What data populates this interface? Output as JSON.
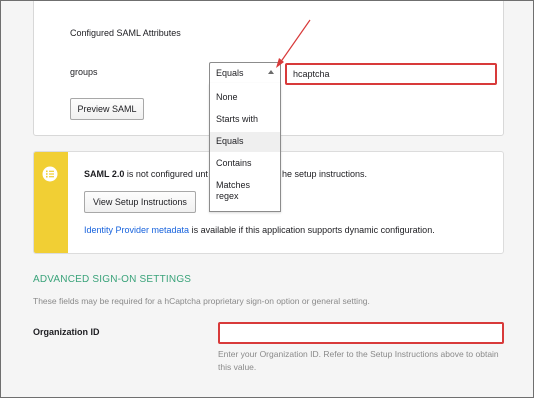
{
  "saml_attributes": {
    "title": "Configured SAML Attributes",
    "attribute_name": "groups",
    "filter_selected": "Equals",
    "filter_options": [
      "None",
      "Starts with",
      "Equals",
      "Contains",
      "Matches regex"
    ],
    "filter_value": "hcaptcha",
    "preview_label": "Preview SAML"
  },
  "notice": {
    "bold": "SAML 2.0",
    "text_before_menu": " is not configured unt",
    "text_after_menu": "he setup instructions.",
    "setup_button": "View Setup Instructions",
    "idp_link": "Identity Provider metadata",
    "idp_text": " is available if this application supports dynamic configuration."
  },
  "advanced": {
    "heading": "ADVANCED SIGN-ON SETTINGS",
    "description": "These fields may be required for a hCaptcha proprietary sign-on option or general setting.",
    "org_label": "Organization ID",
    "org_value": "",
    "org_help": "Enter your Organization ID. Refer to the Setup Instructions above to obtain this value."
  },
  "colors": {
    "accent_green": "#3aa37a",
    "link_blue": "#1662dd",
    "notice_yellow": "#f1cf34",
    "highlight_red": "#d83a3a"
  },
  "icons": {
    "notice": "list-icon",
    "dropdown": "caret-up-icon",
    "annotation": "arrow-annotation"
  }
}
